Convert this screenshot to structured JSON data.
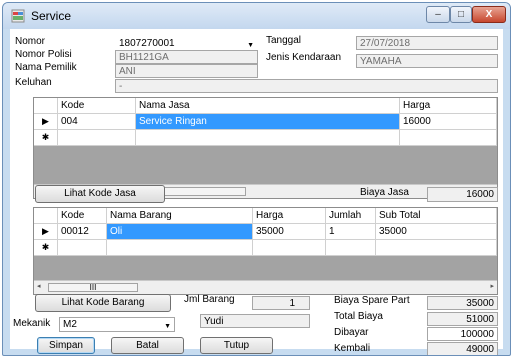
{
  "window": {
    "title": "Service",
    "minimize": "–",
    "maximize": "□",
    "close": "X"
  },
  "header": {
    "nomor_label": "Nomor",
    "nomor_value": "1807270001",
    "polisi_label": "Nomor Polisi",
    "polisi_value": "BH1121GA",
    "pemilik_label": "Nama Pemilik",
    "pemilik_value": "ANI",
    "keluhan_label": "Keluhan",
    "keluhan_value": "-",
    "tanggal_label": "Tanggal",
    "tanggal_value": "27/07/2018",
    "jenis_label": "Jenis Kendaraan",
    "jenis_value": "YAMAHA"
  },
  "jasa_grid": {
    "columns": [
      "Kode",
      "Nama Jasa",
      "Harga"
    ],
    "rows": [
      {
        "marker": "▶",
        "kode": "004",
        "nama": "Service Ringan",
        "harga": "16000"
      }
    ],
    "new_row_marker": "✱"
  },
  "jasa_actions": {
    "lihat_label": "Lihat Kode Jasa",
    "biaya_label": "Biaya Jasa",
    "biaya_value": "16000"
  },
  "barang_grid": {
    "columns": [
      "Kode",
      "Nama Barang",
      "Harga",
      "Jumlah",
      "Sub Total"
    ],
    "rows": [
      {
        "marker": "▶",
        "kode": "00012",
        "nama": "Oli",
        "harga": "35000",
        "jumlah": "1",
        "subtotal": "35000"
      }
    ],
    "new_row_marker": "✱"
  },
  "scroll": {
    "thumb_glyph": "III",
    "left_arrow": "◂",
    "right_arrow": "▸"
  },
  "barang_actions": {
    "lihat_label": "Lihat Kode Barang",
    "jml_label": "Jml Barang",
    "jml_value": "1"
  },
  "mekanik": {
    "label": "Mekanik",
    "value": "M2",
    "name_value": "Yudi"
  },
  "totals": {
    "spare_label": "Biaya Spare Part",
    "spare_value": "35000",
    "total_label": "Total Biaya",
    "total_value": "51000",
    "dibayar_label": "Dibayar",
    "dibayar_value": "100000",
    "kembali_label": "Kembali",
    "kembali_value": "49000"
  },
  "buttons": {
    "simpan": "Simpan",
    "batal": "Batal",
    "tutup": "Tutup"
  }
}
